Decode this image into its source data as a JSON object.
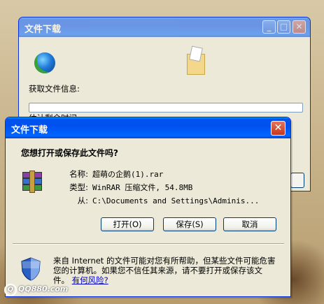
{
  "back_window": {
    "title": "文件下载",
    "status_label": "获取文件信息:",
    "time_label": "估计剩余时间:",
    "buttons": {
      "minimize": "_",
      "maximize": "□",
      "close": "✕"
    }
  },
  "dialog": {
    "title": "文件下载",
    "close": "✕",
    "question": "您想打开或保存此文件吗?",
    "file": {
      "name_label": "名称:",
      "name": "超萌の企鹅(1).rar",
      "type_label": "类型:",
      "type": "WinRAR 压缩文件, 54.8MB",
      "from_label": "从:",
      "from": "C:\\Documents and Settings\\Adminis..."
    },
    "buttons": {
      "open": "打开(O)",
      "save": "保存(S)",
      "cancel": "取消"
    },
    "warning_text": "来自 Internet 的文件可能对您有所帮助，但某些文件可能危害您的计算机。如果您不信任其来源，请不要打开或保存该文件。",
    "warning_link": "有何风险?"
  },
  "watermark": {
    "site": "QQ880.com"
  },
  "icons": [
    "globe-icon",
    "folder-icon",
    "winrar-icon",
    "shield-icon"
  ]
}
